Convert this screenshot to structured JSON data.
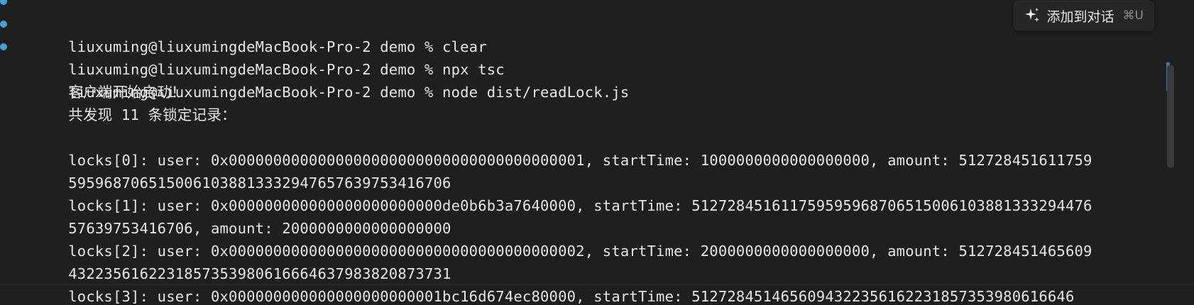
{
  "terminal": {
    "lines": [
      {
        "dot": true,
        "text": "liuxuming@liuxumingdeMacBook-Pro-2 demo % clear"
      },
      {
        "dot": true,
        "text": "liuxuming@liuxumingdeMacBook-Pro-2 demo % npx tsc"
      },
      {
        "dot": true,
        "text": "liuxuming@liuxumingdeMacBook-Pro-2 demo % node dist/readLock.js"
      },
      {
        "dot": false,
        "text": "客户端开始启动！"
      },
      {
        "dot": false,
        "text": "共发现 11 条锁定记录："
      },
      {
        "dot": false,
        "text": ""
      },
      {
        "dot": false,
        "text": "locks[0]: user: 0x0000000000000000000000000000000000000001, startTime: 1000000000000000000, amount: 512728451611759"
      },
      {
        "dot": false,
        "text": "5959687065150061038813332947657639753416706"
      },
      {
        "dot": false,
        "text": "locks[1]: user: 0x000000000000000000000000de0b6b3a7640000, startTime: 512728451611759595968706515006103881333294476"
      },
      {
        "dot": false,
        "text": "57639753416706, amount: 2000000000000000000"
      },
      {
        "dot": false,
        "text": "locks[2]: user: 0x0000000000000000000000000000000000000002, startTime: 2000000000000000000, amount: 512728451465609"
      },
      {
        "dot": false,
        "text": "4322356162231857353980616664637983820873731"
      },
      {
        "dot": false,
        "text": "locks[3]: user: 0x000000000000000000000001bc16d674ec80000, startTime: 5127284514656094322356162231857353980616646"
      }
    ]
  },
  "add_to_chat": {
    "label": "添加到对话",
    "shortcut": "⌘U",
    "icon": "sparkle-icon"
  },
  "colors": {
    "background": "#1f1f20",
    "text": "#e6e6e6",
    "dot": "#4a9fd8"
  }
}
